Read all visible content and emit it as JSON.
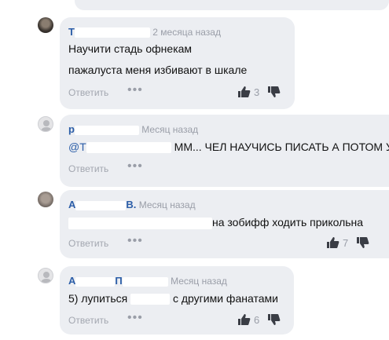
{
  "comments": [
    {
      "author_prefix": "Т",
      "time": "2 месяца назад",
      "lines": [
        "Научити стадь офнекам",
        "пажалуста меня избивают в шкале"
      ],
      "reply_label": "Ответить",
      "likes": "3"
    },
    {
      "author_prefix": "р",
      "time": "Месяц назад",
      "mention_prefix": "@Т",
      "text": "ММ... ЧЕЛ НАУЧИСЬ ПИСАТЬ А ПОТОМ У",
      "reply_label": "Ответить"
    },
    {
      "author_prefix": "А",
      "author_suffix": "В.",
      "time": "Месяц назад",
      "text": "на зобифф ходить прикольна",
      "reply_label": "Ответить",
      "likes": "7"
    },
    {
      "author_prefix": "А",
      "author_suffix": "П",
      "time": "Месяц назад",
      "text_before": "5) лупиться",
      "text_after": "с другими фанатами",
      "reply_label": "Ответить",
      "likes": "6"
    }
  ],
  "icons": {
    "more": "more-dots-icon",
    "like": "thumbs-up-icon",
    "dislike": "thumbs-down-icon"
  },
  "colors": {
    "bubble": "#eceef2",
    "author": "#2c5ea8",
    "muted": "#9a9ea8"
  }
}
